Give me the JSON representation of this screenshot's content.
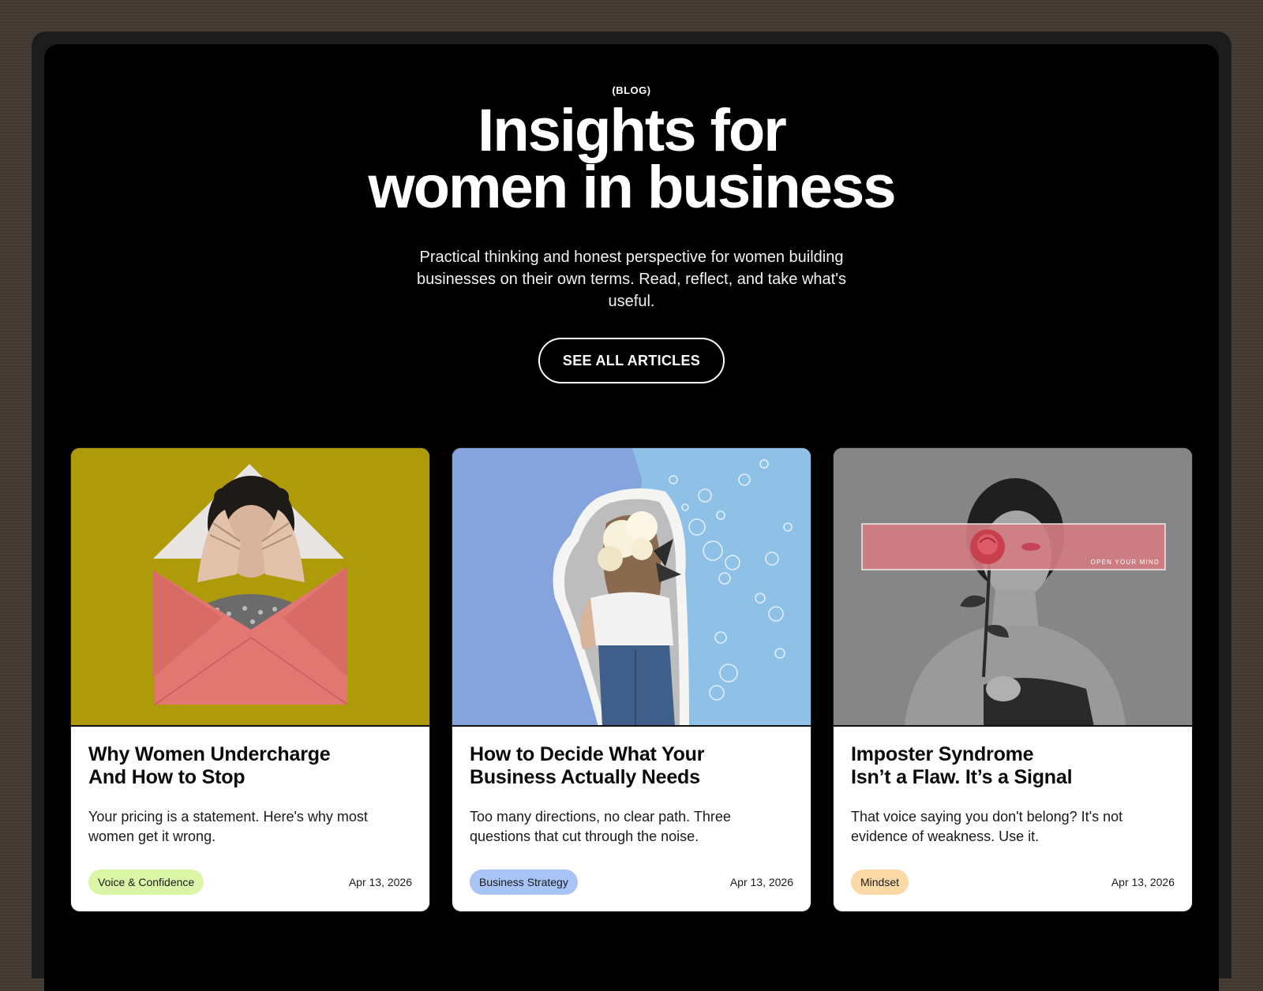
{
  "hero": {
    "eyebrow": "(BLOG)",
    "title_line1": "Insights for",
    "title_line2": "women in business",
    "subtitle": "Practical thinking and honest perspective for women building businesses on their own terms. Read, reflect, and take what's useful.",
    "cta_label": "SEE ALL ARTICLES"
  },
  "cards": [
    {
      "title_line1": "Why Women Undercharge",
      "title_line2": "And How to Stop",
      "excerpt": "Your pricing is a statement. Here's why most women get it wrong.",
      "tag": "Voice & Confidence",
      "tag_color": "#dcf6a8",
      "date": "Apr 13, 2026",
      "image_bg": "#b39f0c"
    },
    {
      "title_line1": "How to Decide What Your",
      "title_line2": "Business Actually Needs",
      "excerpt": "Too many directions, no clear path. Three questions that cut through the noise.",
      "tag": "Business Strategy",
      "tag_color": "#a8c4f7",
      "date": "Apr 13, 2026",
      "image_bg": "#85a3dc"
    },
    {
      "title_line1": "Imposter Syndrome",
      "title_line2": "Isn’t a Flaw. It’s a Signal",
      "excerpt": "That voice saying you don't belong? It's not evidence of weakness. Use it.",
      "tag": "Mindset",
      "tag_color": "#fbd9a6",
      "date": "Apr 13, 2026",
      "image_bg": "#8c8c8c",
      "image_overlay_text": "OPEN YOUR MIND"
    }
  ]
}
